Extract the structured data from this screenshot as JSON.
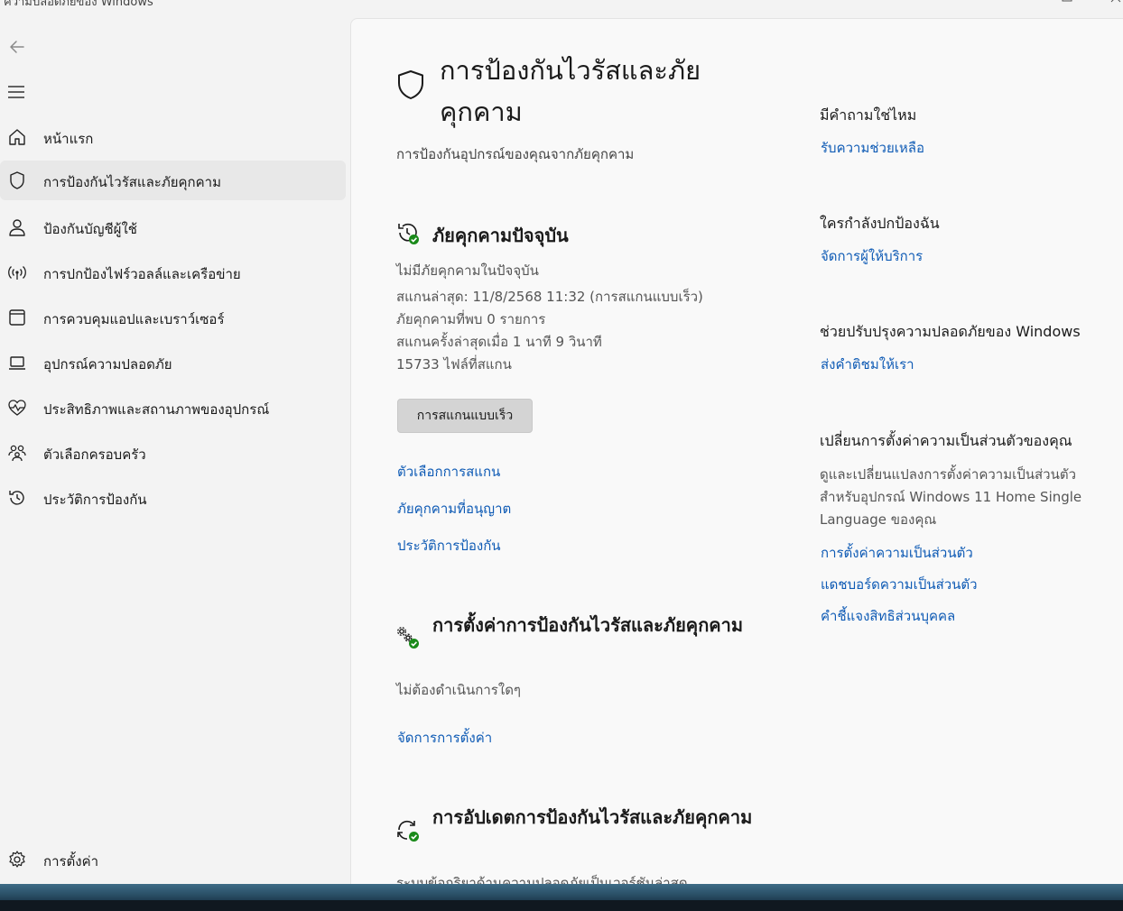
{
  "window": {
    "title": "ความปลอดภัยของ Windows"
  },
  "sidebar": {
    "items": [
      {
        "label": "หน้าแรก",
        "icon": "home-icon"
      },
      {
        "label": "การป้องกันไวรัสและภัยคุกคาม",
        "icon": "shield-icon",
        "selected": true
      },
      {
        "label": "ป้องกันบัญชีผู้ใช้",
        "icon": "person-icon"
      },
      {
        "label": "การปกป้องไฟร์วอลล์และเครือข่าย",
        "icon": "wifi-signal-icon"
      },
      {
        "label": "การควบคุมแอปและเบราว์เซอร์",
        "icon": "browser-window-icon"
      },
      {
        "label": "อุปกรณ์ความปลอดภัย",
        "icon": "laptop-icon"
      },
      {
        "label": "ประสิทธิภาพและสถานภาพของอุปกรณ์",
        "icon": "heart-pulse-icon"
      },
      {
        "label": "ตัวเลือกครอบครัว",
        "icon": "family-icon"
      },
      {
        "label": "ประวัติการป้องกัน",
        "icon": "history-icon"
      }
    ],
    "settings_label": "การตั้งค่า"
  },
  "main": {
    "title": "การป้องกันไวรัสและภัยคุกคาม",
    "subtitle": "การป้องกันอุปกรณ์ของคุณจากภัยคุกคาม",
    "current_threats": {
      "heading": "ภัยคุกคามปัจจุบัน",
      "lines": [
        "ไม่มีภัยคุกคามในปัจจุบัน",
        "สแกนล่าสุด: 11/8/2568 11:32 (การสแกนแบบเร็ว)",
        "ภัยคุกคามที่พบ 0 รายการ",
        "สแกนครั้งล่าสุดเมื่อ 1 นาที 9 วินาที",
        "15733 ไฟล์ที่สแกน"
      ],
      "quick_scan_label": "การสแกนแบบเร็ว",
      "links": [
        "ตัวเลือกการสแกน",
        "ภัยคุกคามที่อนุญาต",
        "ประวัติการป้องกัน"
      ]
    },
    "settings_section": {
      "heading": "การตั้งค่าการป้องกันไวรัสและภัยคุกคาม",
      "status": "ไม่ต้องดำเนินการใดๆ",
      "link": "จัดการการตั้งค่า"
    },
    "updates_section": {
      "heading": "การอัปเดตการป้องกันไวรัสและภัยคุกคาม",
      "status": "ระบบข้อกริยาด้านความปลอดภัยเป็นเวอร์ชันล่าสุด"
    }
  },
  "right_panel": {
    "questions": {
      "heading": "มีคำถามใช่ไหม",
      "link": "รับความช่วยเหลือ"
    },
    "protector": {
      "heading": "ใครกำลังปกป้องฉัน",
      "link": "จัดการผู้ให้บริการ"
    },
    "improve": {
      "heading": "ช่วยปรับปรุงความปลอดภัยของ Windows",
      "link": "ส่งคำติชมให้เรา"
    },
    "privacy": {
      "heading": "เปลี่ยนการตั้งค่าความเป็นส่วนตัวของคุณ",
      "description": "ดูและเปลี่ยนแปลงการตั้งค่าความเป็นส่วนตัวสำหรับอุปกรณ์ Windows 11 Home Single Language ของคุณ",
      "links": [
        "การตั้งค่าความเป็นส่วนตัว",
        "แดชบอร์ดความเป็นส่วนตัว",
        "คำชี้แจงสิทธิส่วนบุคคล"
      ]
    }
  },
  "colors": {
    "link": "#0f5bb5",
    "check_green": "#1a8a1a",
    "selected_bg": "#e8e8e8"
  }
}
